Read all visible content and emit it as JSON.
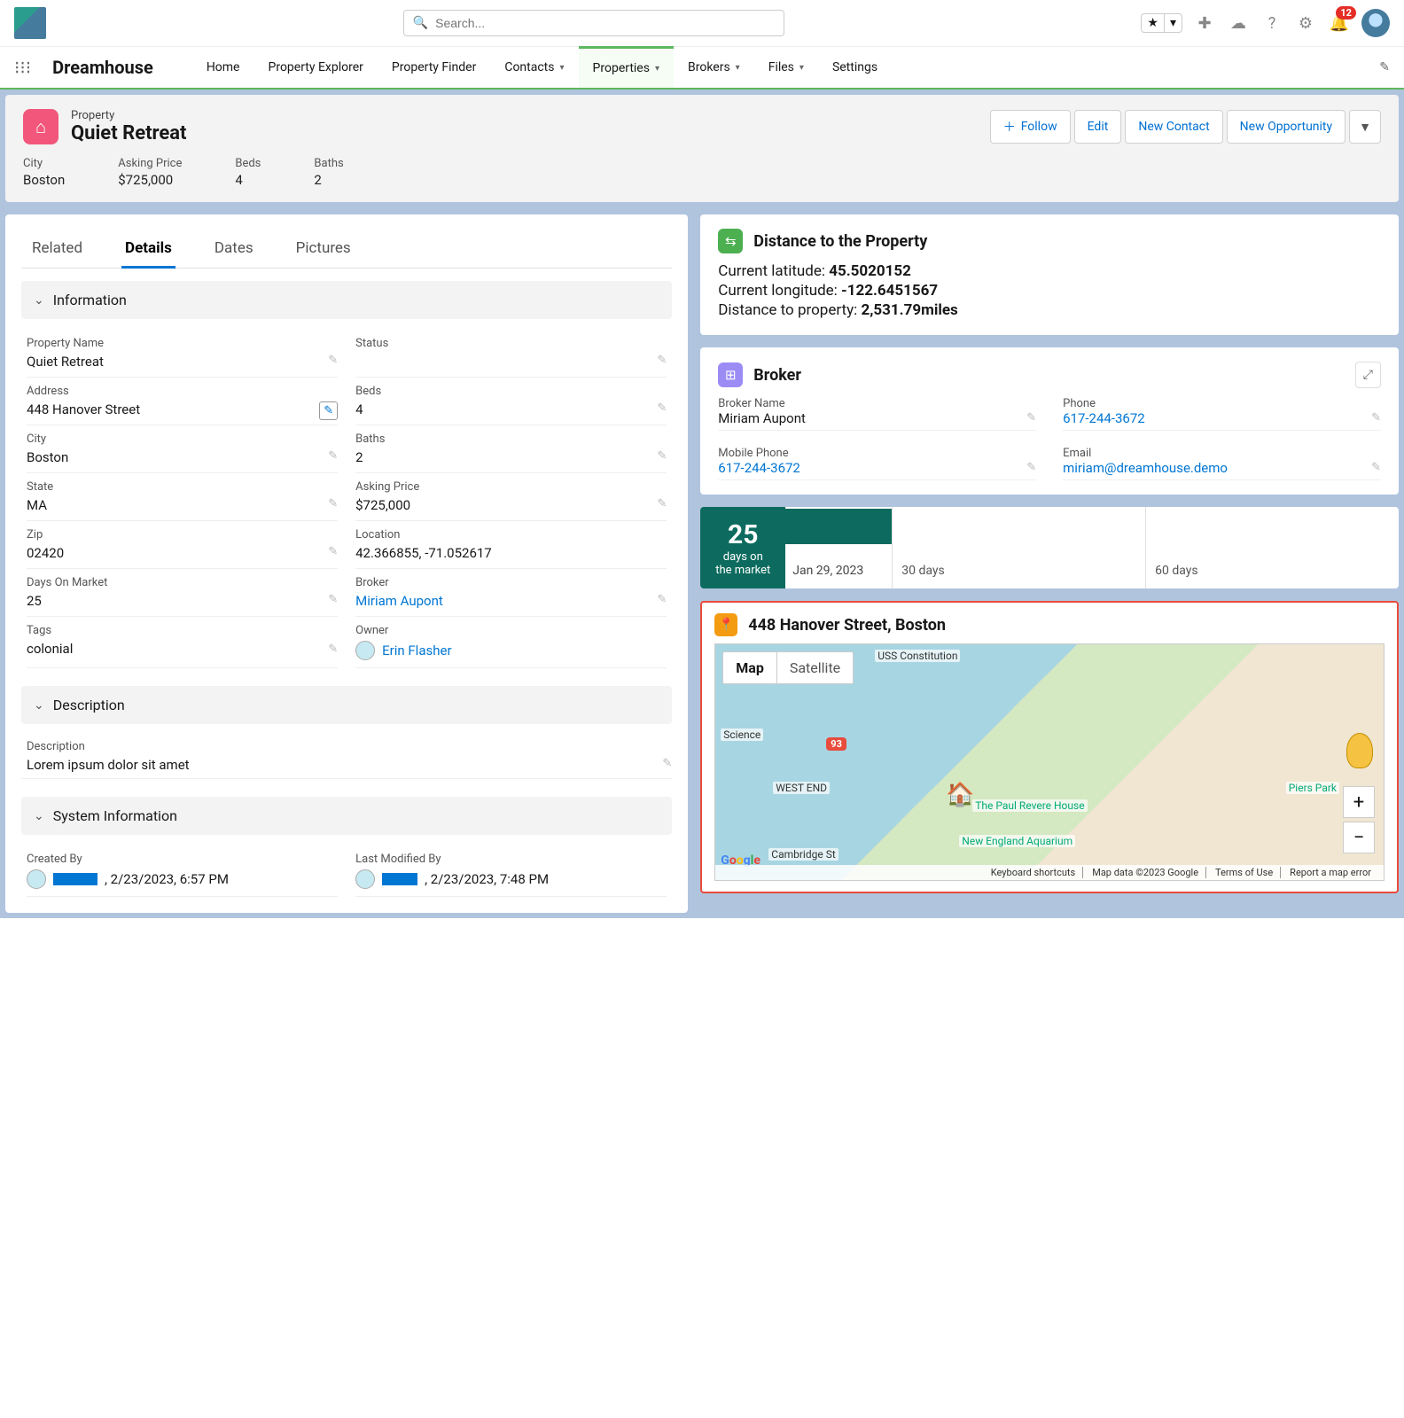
{
  "search": {
    "placeholder": "Search..."
  },
  "notifications": {
    "count": "12"
  },
  "app": {
    "name": "Dreamhouse"
  },
  "nav": {
    "home": "Home",
    "propExplorer": "Property Explorer",
    "propFinder": "Property Finder",
    "contacts": "Contacts",
    "properties": "Properties",
    "brokers": "Brokers",
    "files": "Files",
    "settings": "Settings"
  },
  "record": {
    "objectLabel": "Property",
    "name": "Quiet Retreat",
    "actions": {
      "follow": "Follow",
      "edit": "Edit",
      "newContact": "New Contact",
      "newOpp": "New Opportunity"
    },
    "highlights": {
      "cityL": "City",
      "city": "Boston",
      "priceL": "Asking Price",
      "price": "$725,000",
      "bedsL": "Beds",
      "beds": "4",
      "bathsL": "Baths",
      "baths": "2"
    }
  },
  "tabs": {
    "related": "Related",
    "details": "Details",
    "dates": "Dates",
    "pictures": "Pictures"
  },
  "sections": {
    "info": "Information",
    "desc": "Description",
    "sys": "System Information"
  },
  "fields": {
    "propNameL": "Property Name",
    "propName": "Quiet Retreat",
    "statusL": "Status",
    "status": "",
    "addressL": "Address",
    "address": "448 Hanover Street",
    "bedsL": "Beds",
    "beds": "4",
    "cityL": "City",
    "city": "Boston",
    "bathsL": "Baths",
    "baths": "2",
    "stateL": "State",
    "state": "MA",
    "priceL": "Asking Price",
    "price": "$725,000",
    "zipL": "Zip",
    "zip": "02420",
    "locL": "Location",
    "loc": "42.366855, -71.052617",
    "domL": "Days On Market",
    "dom": "25",
    "brokerL": "Broker",
    "broker": "Miriam Aupont",
    "tagsL": "Tags",
    "tags": "colonial",
    "ownerL": "Owner",
    "owner": "Erin Flasher",
    "descL": "Description",
    "desc": "Lorem ipsum dolor sit amet",
    "createdL": "Created By",
    "createdDate": ", 2/23/2023, 6:57 PM",
    "modL": "Last Modified By",
    "modDate": ", 2/23/2023, 7:48 PM"
  },
  "distance": {
    "title": "Distance to the Property",
    "latL": "Current latitude: ",
    "lat": "45.5020152",
    "lonL": "Current longitude: ",
    "lon": "-122.6451567",
    "distL": "Distance to property: ",
    "dist": "2,531.79miles"
  },
  "brokerCard": {
    "title": "Broker",
    "nameL": "Broker Name",
    "name": "Miriam Aupont",
    "phoneL": "Phone",
    "phone": "617-244-3672",
    "mobileL": "Mobile Phone",
    "mobile": "617-244-3672",
    "emailL": "Email",
    "email": "miriam@dreamhouse.demo"
  },
  "timeline": {
    "days": "25",
    "label1": "days on",
    "label2": "the market",
    "start": "Jan 29, 2023",
    "m30": "30 days",
    "m60": "60 days"
  },
  "map": {
    "title": "448 Hanover Street, Boston",
    "map": "Map",
    "sat": "Satellite",
    "shortcuts": "Keyboard shortcuts",
    "data": "Map data ©2023 Google",
    "terms": "Terms of Use",
    "report": "Report a map error"
  }
}
